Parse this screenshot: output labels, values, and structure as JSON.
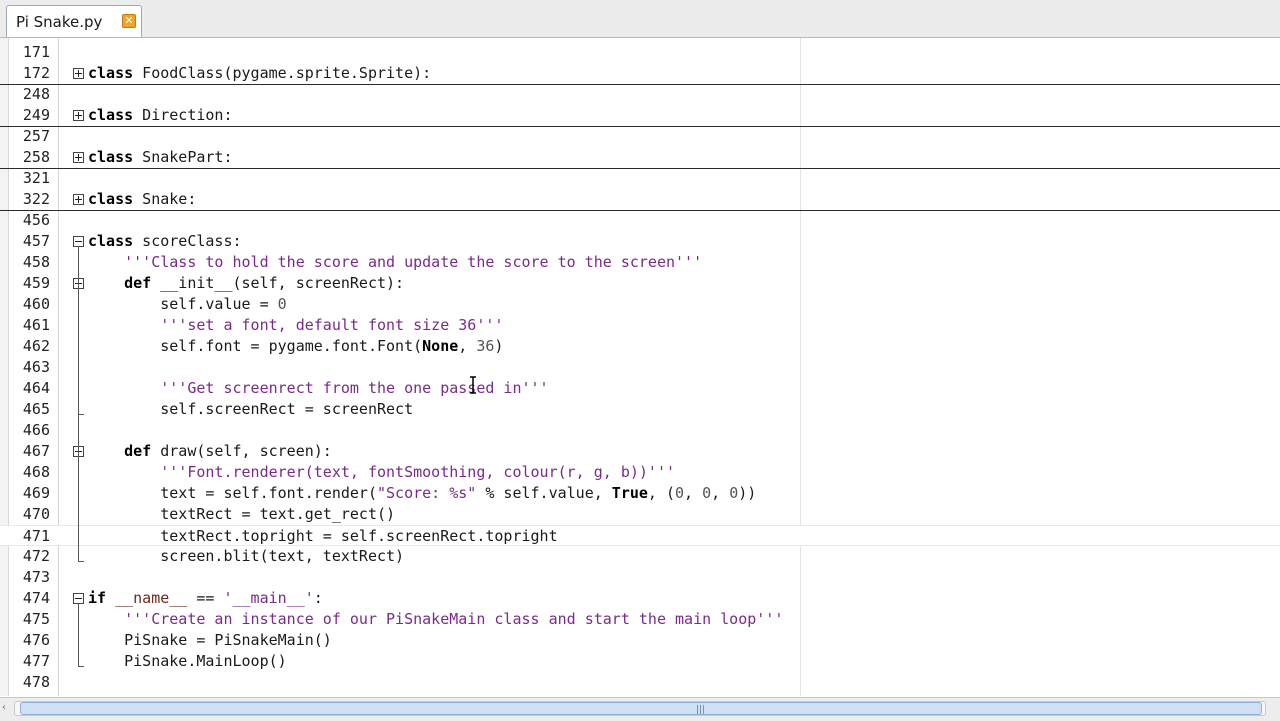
{
  "tab": {
    "title": "Pi Snake.py",
    "close_label": "✕"
  },
  "lines": [
    {
      "n": "171",
      "sep": false
    },
    {
      "n": "172",
      "sep": true,
      "fold": "plus",
      "html": "<span class=\"kw\">class</span> FoodClass(pygame.sprite.Sprite):"
    },
    {
      "n": "248",
      "sep": false
    },
    {
      "n": "249",
      "sep": true,
      "fold": "plus",
      "html": "<span class=\"kw\">class</span> Direction:"
    },
    {
      "n": "257",
      "sep": false
    },
    {
      "n": "258",
      "sep": true,
      "fold": "plus",
      "html": "<span class=\"kw\">class</span> SnakePart:"
    },
    {
      "n": "321",
      "sep": false
    },
    {
      "n": "322",
      "sep": true,
      "fold": "plus",
      "html": "<span class=\"kw\">class</span> Snake:"
    },
    {
      "n": "456",
      "sep": false
    },
    {
      "n": "457",
      "fold": "minus",
      "html": "<span class=\"kw\">class</span> scoreClass:"
    },
    {
      "n": "458",
      "html": "    <span class=\"str\">'''Class to hold the score and update the score to the screen'''</span>"
    },
    {
      "n": "459",
      "fold": "minus",
      "html": "    <span class=\"kw\">def</span> __init__(self, screenRect):"
    },
    {
      "n": "460",
      "html": "        self.value = <span class=\"num\">0</span>"
    },
    {
      "n": "461",
      "html": "        <span class=\"str\">'''set a font, default font size 36'''</span>"
    },
    {
      "n": "462",
      "html": "        self.font = pygame.font.Font(<span class=\"kw\">None</span>, <span class=\"num\">36</span>)"
    },
    {
      "n": "463",
      "html": ""
    },
    {
      "n": "464",
      "html": "        <span class=\"str\">'''Get screenrect from the one passed in'''</span>"
    },
    {
      "n": "465",
      "html": "        self.screenRect = screenRect"
    },
    {
      "n": "466",
      "html": ""
    },
    {
      "n": "467",
      "fold": "minus",
      "html": "    <span class=\"kw\">def</span> draw(self, screen):"
    },
    {
      "n": "468",
      "html": "        <span class=\"str\">'''Font.renderer(text, fontSmoothing, colour(r, g, b))'''</span>"
    },
    {
      "n": "469",
      "html": "        text = self.font.render(<span class=\"str\">\"Score: %s\"</span> % self.value, <span class=\"kw\">True</span>, (<span class=\"num\">0</span>, <span class=\"num\">0</span>, <span class=\"num\">0</span>))"
    },
    {
      "n": "470",
      "html": "        textRect = text.get_rect()"
    },
    {
      "n": "471",
      "cur": true,
      "html": "        textRect.topright = self.screenRect.topright"
    },
    {
      "n": "472",
      "html": "        screen.blit(text, textRect)"
    },
    {
      "n": "473",
      "html": ""
    },
    {
      "n": "474",
      "fold": "minus",
      "html": "<span class=\"kw\">if</span> <span class=\"dunder\">__name__</span> == <span class=\"str\">'__main__'</span>:"
    },
    {
      "n": "475",
      "html": "    <span class=\"str\">'''Create an instance of our PiSnakeMain class and start the main loop'''</span>"
    },
    {
      "n": "476",
      "html": "    PiSnake = PiSnakeMain()"
    },
    {
      "n": "477",
      "html": "    PiSnake.MainLoop()"
    },
    {
      "n": "478",
      "html": ""
    }
  ]
}
